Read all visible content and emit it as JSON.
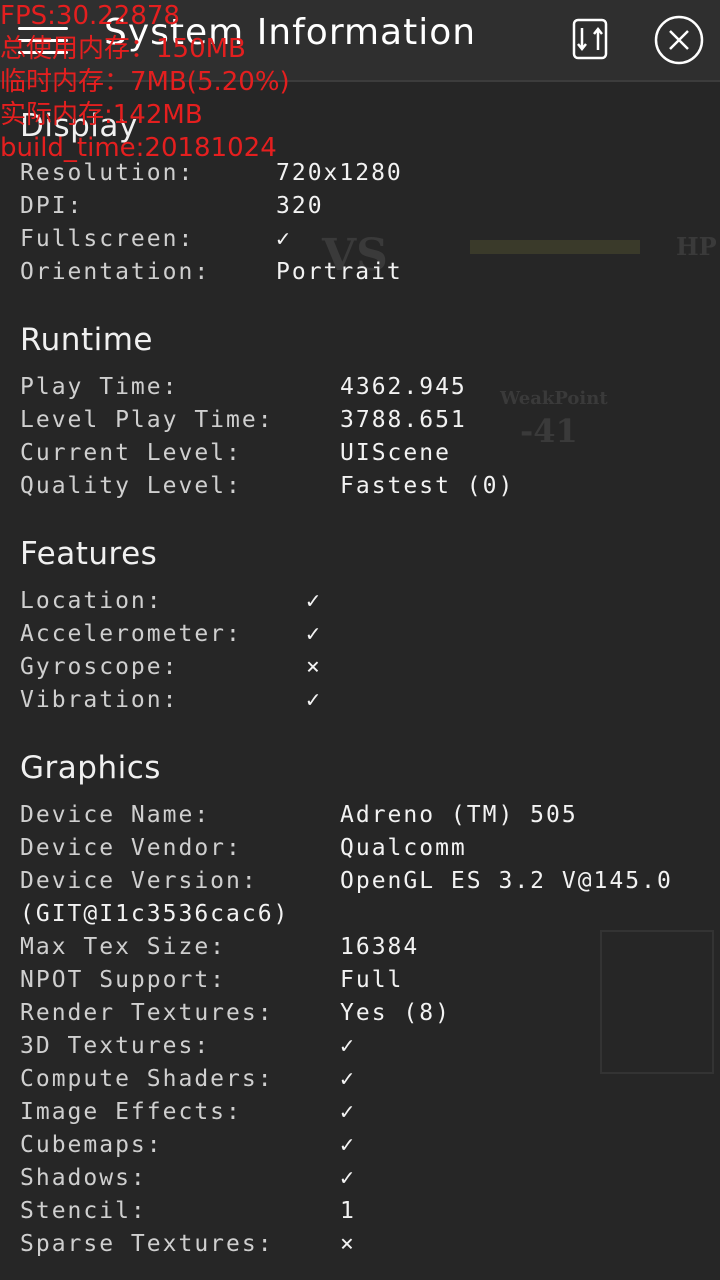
{
  "header": {
    "title": "System Information",
    "menu_icon": "hamburger-icon",
    "rotate_icon": "rotate-screen-icon",
    "close_icon": "close-icon"
  },
  "overlay": {
    "fps": "FPS:30.22878",
    "mem_used": "总使用内存：150MB",
    "mem_temp": "临时内存：7MB(5.20%)",
    "mem_actual": "实际内存:142MB",
    "build_time": "build_time:20181024"
  },
  "sections": {
    "display": {
      "title": "Display",
      "rows": [
        {
          "k": "Resolution:",
          "v": "720x1280"
        },
        {
          "k": "DPI:",
          "v": "320"
        },
        {
          "k": "Fullscreen:",
          "v": "✓"
        },
        {
          "k": "Orientation:",
          "v": "Portrait"
        }
      ]
    },
    "runtime": {
      "title": "Runtime",
      "rows": [
        {
          "k": "Play Time:",
          "v": "4362.945"
        },
        {
          "k": "Level Play Time:",
          "v": "3788.651"
        },
        {
          "k": "Current Level:",
          "v": "UIScene"
        },
        {
          "k": "Quality Level:",
          "v": "Fastest (0)"
        }
      ]
    },
    "features": {
      "title": "Features",
      "rows": [
        {
          "k": "Location:",
          "v": "✓"
        },
        {
          "k": "Accelerometer:",
          "v": "✓"
        },
        {
          "k": "Gyroscope:",
          "v": "×"
        },
        {
          "k": "Vibration:",
          "v": "✓"
        }
      ]
    },
    "graphics": {
      "title": "Graphics",
      "rows": [
        {
          "k": "Device Name:",
          "v": "Adreno (TM) 505"
        },
        {
          "k": "Device Vendor:",
          "v": "Qualcomm"
        },
        {
          "k": "Device Version:",
          "v": "OpenGL ES 3.2 V@145.0"
        },
        {
          "k": "",
          "v": "(GIT@I1c3536cac6)"
        },
        {
          "k": "Max Tex Size:",
          "v": "16384"
        },
        {
          "k": "NPOT Support:",
          "v": "Full"
        },
        {
          "k": "Render Textures:",
          "v": "Yes (8)"
        },
        {
          "k": "3D Textures:",
          "v": "✓"
        },
        {
          "k": "Compute Shaders:",
          "v": "✓"
        },
        {
          "k": "Image Effects:",
          "v": "✓"
        },
        {
          "k": "Cubemaps:",
          "v": "✓"
        },
        {
          "k": "Shadows:",
          "v": "✓"
        },
        {
          "k": "Stencil:",
          "v": "1"
        },
        {
          "k": "Sparse Textures:",
          "v": "×"
        }
      ]
    }
  },
  "background_text": {
    "vs": "VS",
    "hp": "HP",
    "weakpoint": "WeakPoint",
    "damage": "-41"
  }
}
